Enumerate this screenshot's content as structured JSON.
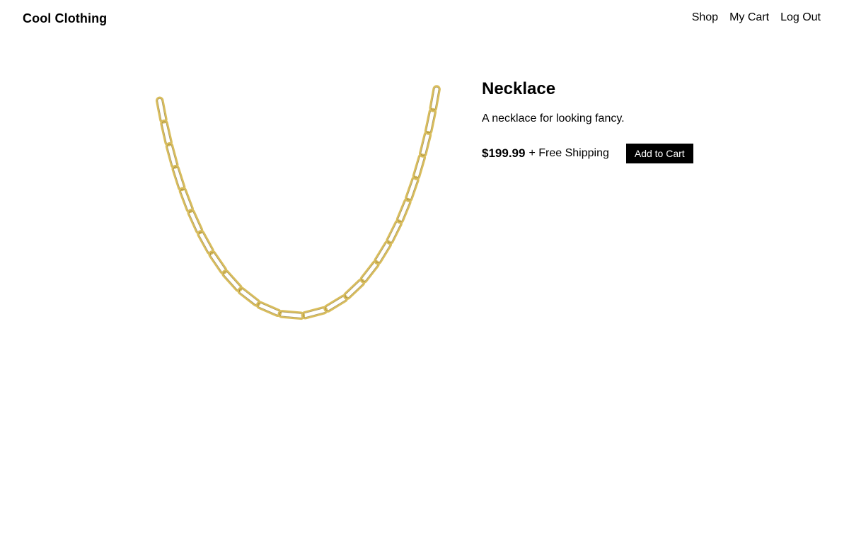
{
  "header": {
    "brand": "Cool Clothing",
    "nav": {
      "shop": "Shop",
      "cart": "My Cart",
      "logout": "Log Out"
    }
  },
  "product": {
    "name": "Necklace",
    "description": "A necklace for looking fancy.",
    "price": "$199.99",
    "shipping": "+ Free Shipping",
    "add_to_cart_label": "Add to Cart",
    "image_icon": "gold-paperclip-chain-necklace",
    "chain_color": "#d9bd5c"
  },
  "colors": {
    "background": "#ffffff",
    "text": "#000000",
    "button_bg": "#000000",
    "button_text": "#ffffff"
  }
}
